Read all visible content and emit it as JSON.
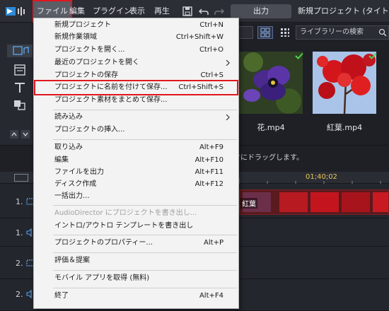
{
  "menubar": {
    "items": [
      "ファイル",
      "編集",
      "プラグイン",
      "表示",
      "再生"
    ],
    "output_label": "出力",
    "project_title": "新規プロジェクト (タイトルなし)*",
    "logo_icon": "power-director-logo-icon"
  },
  "library": {
    "search_placeholder": "ライブラリーの検索",
    "thumbnails": [
      {
        "label": "花.mp4"
      },
      {
        "label": "紅葉.mp4"
      }
    ],
    "hint": "ックにドラッグします。"
  },
  "timeline": {
    "timecode": "01;40;02",
    "tracks": [
      {
        "label": "1."
      },
      {
        "label": "1."
      },
      {
        "label": "2."
      },
      {
        "label": "2."
      }
    ],
    "clip_label": "紅葉"
  },
  "file_menu": {
    "items": [
      {
        "label": "新規プロジェクト",
        "shortcut": "Ctrl+N"
      },
      {
        "label": "新規作業領域",
        "shortcut": "Ctrl+Shift+W"
      },
      {
        "label": "プロジェクトを開く...",
        "shortcut": "Ctrl+O"
      },
      {
        "label": "最近のプロジェクトを開く",
        "shortcut": ""
      },
      {
        "label": "プロジェクトの保存",
        "shortcut": "Ctrl+S"
      },
      {
        "label": "プロジェクトに名前を付けて保存...",
        "shortcut": "Ctrl+Shift+S"
      },
      {
        "label": "プロジェクト素材をまとめて保存...",
        "shortcut": ""
      },
      {
        "label": "読み込み",
        "shortcut": ""
      },
      {
        "label": "プロジェクトの挿入...",
        "shortcut": ""
      },
      {
        "label": "取り込み",
        "shortcut": "Alt+F9"
      },
      {
        "label": "編集",
        "shortcut": "Alt+F10"
      },
      {
        "label": "ファイルを出力",
        "shortcut": "Alt+F11"
      },
      {
        "label": "ディスク作成",
        "shortcut": "Alt+F12"
      },
      {
        "label": "一括出力...",
        "shortcut": ""
      },
      {
        "label": "AudioDirector にプロジェクトを書き出し...",
        "shortcut": ""
      },
      {
        "label": "イントロ/アウトロ テンプレートを書き出し",
        "shortcut": ""
      },
      {
        "label": "プロジェクトのプロパティー...",
        "shortcut": "Alt+P"
      },
      {
        "label": "評価＆提案",
        "shortcut": ""
      },
      {
        "label": "モバイル アプリを取得 (無料)",
        "shortcut": ""
      },
      {
        "label": "終了",
        "shortcut": "Alt+F4"
      }
    ]
  },
  "colors": {
    "highlight_outline": "#e0171f",
    "timecode": "#e8c55a"
  }
}
